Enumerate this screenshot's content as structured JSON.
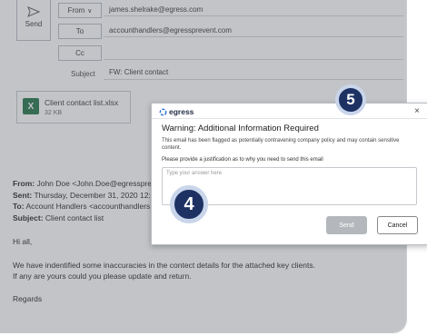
{
  "toolbar": {
    "send_label": "Send"
  },
  "header": {
    "from_label": "From",
    "from_value": "james.shelrake@egress.com",
    "to_label": "To",
    "to_value": "accounthandlers@egressprevent.com",
    "cc_label": "Cc",
    "subject_label": "Subject",
    "subject_value": "FW: Client contact"
  },
  "attachment": {
    "name": "Client contact list.xlsx",
    "size": "32 KB",
    "icon_letter": "X"
  },
  "email_body": {
    "from_line_label": "From:",
    "from_line_value": "John Doe <John.Doe@egressprevent",
    "sent_label": "Sent:",
    "sent_value": "Thursday, December 31, 2020 12:",
    "to_label": "To:",
    "to_value": "Account Handlers <accounthandlers",
    "subject_label": "Subject:",
    "subject_value": "Client contact list",
    "greeting": "Hi all,",
    "paragraph_line1": "We have indentified some inaccuracies in the contect details for the attached key clients.",
    "paragraph_line2": "If any are yours could you please update and return.",
    "signoff": "Regards"
  },
  "dialog": {
    "logo_text": "egress",
    "close_glyph": "×",
    "title": "Warning: Additional Information Required",
    "message": "This email has been flagged as potentially contravening company policy and may contain sensitive content.",
    "prompt": "Please provide a justification as to why you need to send this email",
    "input_placeholder": "Type your answer here",
    "send_label": "Send",
    "cancel_label": "Cancel"
  },
  "markers": {
    "step_5": "5",
    "step_4": "4"
  },
  "colors": {
    "marker_fill": "#1d3163",
    "excel_green": "#1e7145",
    "overlay": "#5f646c"
  }
}
